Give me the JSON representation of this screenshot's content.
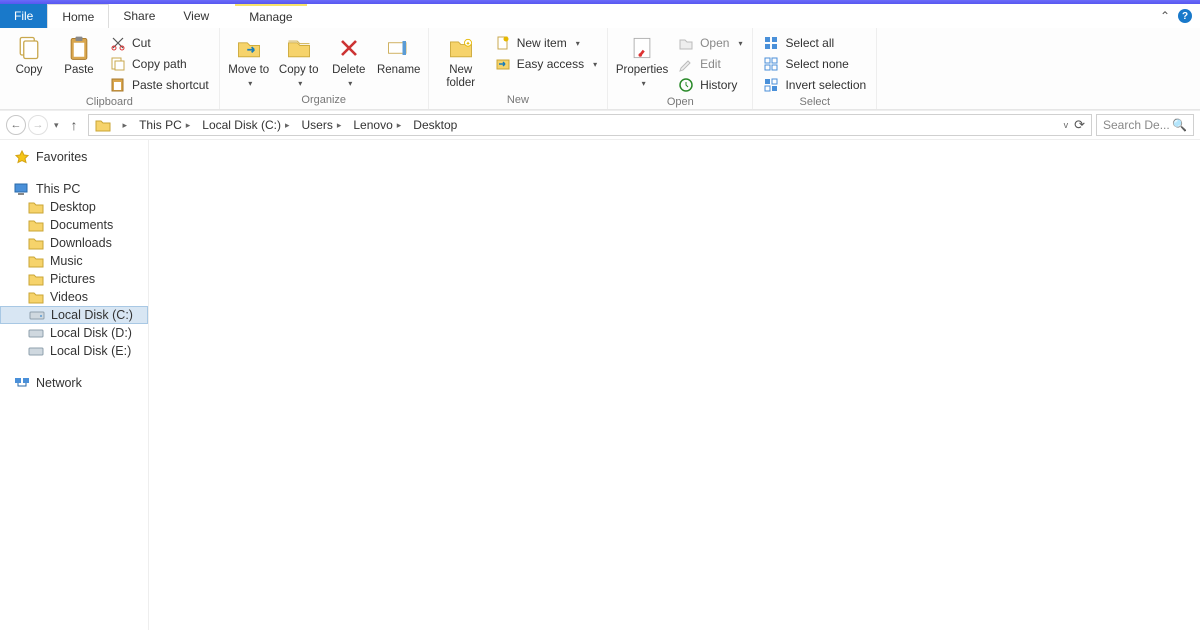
{
  "tabs": {
    "file": "File",
    "home": "Home",
    "share": "Share",
    "view": "View",
    "manage": "Manage"
  },
  "ribbon": {
    "clipboard": {
      "copy": "Copy",
      "paste": "Paste",
      "cut": "Cut",
      "copy_path": "Copy path",
      "paste_shortcut": "Paste shortcut",
      "label": "Clipboard"
    },
    "organize": {
      "move_to": "Move to",
      "copy_to": "Copy to",
      "delete": "Delete",
      "rename": "Rename",
      "label": "Organize"
    },
    "new": {
      "new_folder": "New folder",
      "new_item": "New item",
      "easy_access": "Easy access",
      "label": "New"
    },
    "open": {
      "properties": "Properties",
      "open": "Open",
      "edit": "Edit",
      "history": "History",
      "label": "Open"
    },
    "select": {
      "select_all": "Select all",
      "select_none": "Select none",
      "invert": "Invert selection",
      "label": "Select"
    }
  },
  "address": {
    "crumbs": [
      "This PC",
      "Local Disk (C:)",
      "Users",
      "Lenovo",
      "Desktop"
    ]
  },
  "search_placeholder": "Search De...",
  "nav": {
    "favorites": "Favorites",
    "this_pc": "This PC",
    "items": [
      "Desktop",
      "Documents",
      "Downloads",
      "Music",
      "Pictures",
      "Videos",
      "Local Disk (C:)",
      "Local Disk (D:)",
      "Local Disk (E:)"
    ],
    "network": "Network"
  }
}
